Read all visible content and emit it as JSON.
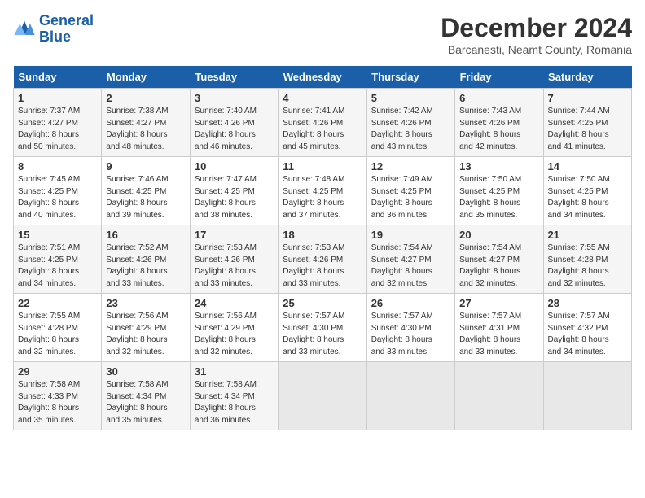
{
  "header": {
    "logo_line1": "General",
    "logo_line2": "Blue",
    "month": "December 2024",
    "location": "Barcanesti, Neamt County, Romania"
  },
  "days_of_week": [
    "Sunday",
    "Monday",
    "Tuesday",
    "Wednesday",
    "Thursday",
    "Friday",
    "Saturday"
  ],
  "weeks": [
    [
      {
        "day": "1",
        "info": "Sunrise: 7:37 AM\nSunset: 4:27 PM\nDaylight: 8 hours\nand 50 minutes."
      },
      {
        "day": "2",
        "info": "Sunrise: 7:38 AM\nSunset: 4:27 PM\nDaylight: 8 hours\nand 48 minutes."
      },
      {
        "day": "3",
        "info": "Sunrise: 7:40 AM\nSunset: 4:26 PM\nDaylight: 8 hours\nand 46 minutes."
      },
      {
        "day": "4",
        "info": "Sunrise: 7:41 AM\nSunset: 4:26 PM\nDaylight: 8 hours\nand 45 minutes."
      },
      {
        "day": "5",
        "info": "Sunrise: 7:42 AM\nSunset: 4:26 PM\nDaylight: 8 hours\nand 43 minutes."
      },
      {
        "day": "6",
        "info": "Sunrise: 7:43 AM\nSunset: 4:26 PM\nDaylight: 8 hours\nand 42 minutes."
      },
      {
        "day": "7",
        "info": "Sunrise: 7:44 AM\nSunset: 4:25 PM\nDaylight: 8 hours\nand 41 minutes."
      }
    ],
    [
      {
        "day": "8",
        "info": "Sunrise: 7:45 AM\nSunset: 4:25 PM\nDaylight: 8 hours\nand 40 minutes."
      },
      {
        "day": "9",
        "info": "Sunrise: 7:46 AM\nSunset: 4:25 PM\nDaylight: 8 hours\nand 39 minutes."
      },
      {
        "day": "10",
        "info": "Sunrise: 7:47 AM\nSunset: 4:25 PM\nDaylight: 8 hours\nand 38 minutes."
      },
      {
        "day": "11",
        "info": "Sunrise: 7:48 AM\nSunset: 4:25 PM\nDaylight: 8 hours\nand 37 minutes."
      },
      {
        "day": "12",
        "info": "Sunrise: 7:49 AM\nSunset: 4:25 PM\nDaylight: 8 hours\nand 36 minutes."
      },
      {
        "day": "13",
        "info": "Sunrise: 7:50 AM\nSunset: 4:25 PM\nDaylight: 8 hours\nand 35 minutes."
      },
      {
        "day": "14",
        "info": "Sunrise: 7:50 AM\nSunset: 4:25 PM\nDaylight: 8 hours\nand 34 minutes."
      }
    ],
    [
      {
        "day": "15",
        "info": "Sunrise: 7:51 AM\nSunset: 4:25 PM\nDaylight: 8 hours\nand 34 minutes."
      },
      {
        "day": "16",
        "info": "Sunrise: 7:52 AM\nSunset: 4:26 PM\nDaylight: 8 hours\nand 33 minutes."
      },
      {
        "day": "17",
        "info": "Sunrise: 7:53 AM\nSunset: 4:26 PM\nDaylight: 8 hours\nand 33 minutes."
      },
      {
        "day": "18",
        "info": "Sunrise: 7:53 AM\nSunset: 4:26 PM\nDaylight: 8 hours\nand 33 minutes."
      },
      {
        "day": "19",
        "info": "Sunrise: 7:54 AM\nSunset: 4:27 PM\nDaylight: 8 hours\nand 32 minutes."
      },
      {
        "day": "20",
        "info": "Sunrise: 7:54 AM\nSunset: 4:27 PM\nDaylight: 8 hours\nand 32 minutes."
      },
      {
        "day": "21",
        "info": "Sunrise: 7:55 AM\nSunset: 4:28 PM\nDaylight: 8 hours\nand 32 minutes."
      }
    ],
    [
      {
        "day": "22",
        "info": "Sunrise: 7:55 AM\nSunset: 4:28 PM\nDaylight: 8 hours\nand 32 minutes."
      },
      {
        "day": "23",
        "info": "Sunrise: 7:56 AM\nSunset: 4:29 PM\nDaylight: 8 hours\nand 32 minutes."
      },
      {
        "day": "24",
        "info": "Sunrise: 7:56 AM\nSunset: 4:29 PM\nDaylight: 8 hours\nand 32 minutes."
      },
      {
        "day": "25",
        "info": "Sunrise: 7:57 AM\nSunset: 4:30 PM\nDaylight: 8 hours\nand 33 minutes."
      },
      {
        "day": "26",
        "info": "Sunrise: 7:57 AM\nSunset: 4:30 PM\nDaylight: 8 hours\nand 33 minutes."
      },
      {
        "day": "27",
        "info": "Sunrise: 7:57 AM\nSunset: 4:31 PM\nDaylight: 8 hours\nand 33 minutes."
      },
      {
        "day": "28",
        "info": "Sunrise: 7:57 AM\nSunset: 4:32 PM\nDaylight: 8 hours\nand 34 minutes."
      }
    ],
    [
      {
        "day": "29",
        "info": "Sunrise: 7:58 AM\nSunset: 4:33 PM\nDaylight: 8 hours\nand 35 minutes."
      },
      {
        "day": "30",
        "info": "Sunrise: 7:58 AM\nSunset: 4:34 PM\nDaylight: 8 hours\nand 35 minutes."
      },
      {
        "day": "31",
        "info": "Sunrise: 7:58 AM\nSunset: 4:34 PM\nDaylight: 8 hours\nand 36 minutes."
      },
      {
        "day": "",
        "info": ""
      },
      {
        "day": "",
        "info": ""
      },
      {
        "day": "",
        "info": ""
      },
      {
        "day": "",
        "info": ""
      }
    ]
  ]
}
